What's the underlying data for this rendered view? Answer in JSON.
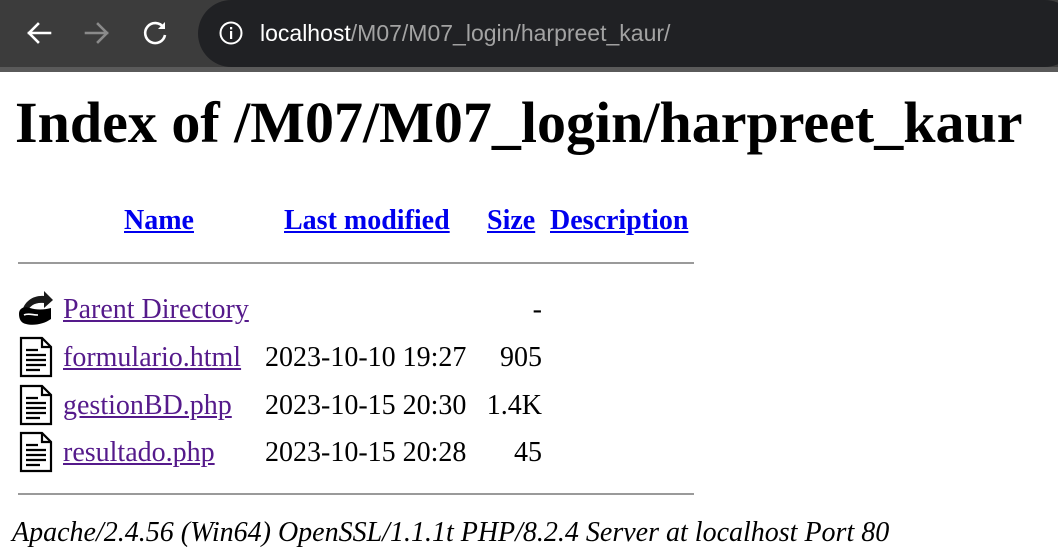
{
  "browser": {
    "url_host": "localhost",
    "url_path": "/M07/M07_login/harpreet_kaur/",
    "icons": {
      "back": "arrow-left-icon",
      "forward": "arrow-right-icon",
      "reload": "reload-icon",
      "site_info": "info-icon"
    },
    "colors": {
      "toolbar": "#3c3c3c",
      "omnibox": "#202124",
      "url_host": "#ffffff",
      "url_path": "#a3a3a3"
    }
  },
  "page": {
    "title": "Index of /M07/M07_login/harpreet_kaur",
    "columns": {
      "name": "Name",
      "last_modified": "Last modified",
      "size": "Size",
      "description": "Description"
    },
    "rows": [
      {
        "icon": "parent-directory-icon",
        "name": "Parent Directory",
        "modified": "",
        "size": "-"
      },
      {
        "icon": "text-file-icon",
        "name": "formulario.html",
        "modified": "2023-10-10 19:27",
        "size": "905"
      },
      {
        "icon": "text-file-icon",
        "name": "gestionBD.php",
        "modified": "2023-10-15 20:30",
        "size": "1.4K"
      },
      {
        "icon": "text-file-icon",
        "name": "resultado.php",
        "modified": "2023-10-15 20:28",
        "size": "45"
      }
    ],
    "footer": "Apache/2.4.56 (Win64) OpenSSL/1.1.1t PHP/8.2.4 Server at localhost Port 80",
    "colors": {
      "link": "#0000ee",
      "visited_link": "#551a8b",
      "rule": "#9a9a9a"
    }
  }
}
